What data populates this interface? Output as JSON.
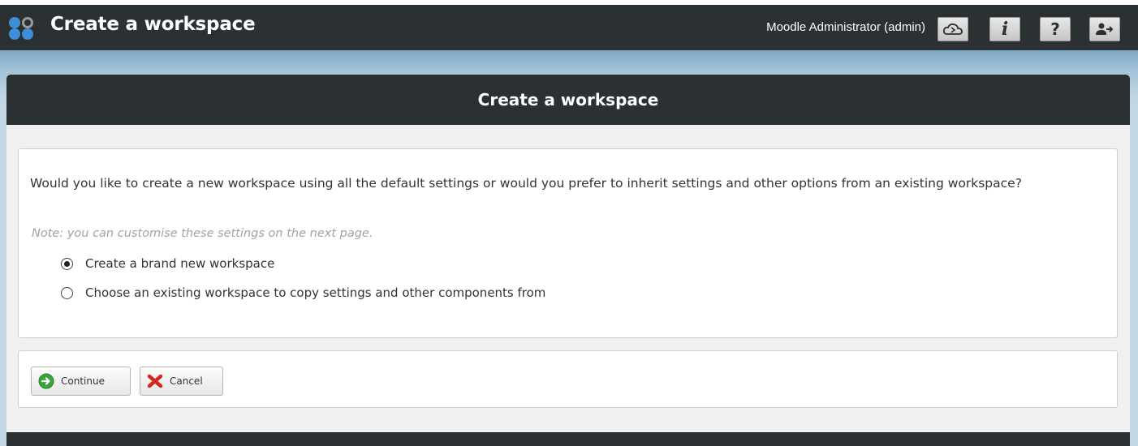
{
  "topbar": {
    "app_title": "Create a workspace",
    "user_name": "Moodle Administrator (admin)",
    "buttons": [
      {
        "icon": "cloud-icon"
      },
      {
        "icon": "info-icon",
        "glyph": "i"
      },
      {
        "icon": "help-icon",
        "glyph": "?"
      },
      {
        "icon": "logout-icon"
      }
    ]
  },
  "panel": {
    "title": "Create a workspace",
    "question": "Would you like to create a new workspace using all the default settings or would you prefer to inherit settings and other options from an existing workspace?",
    "note": "Note: you can customise these settings on the next page.",
    "options": [
      {
        "label": "Create a brand new workspace",
        "selected": true
      },
      {
        "label": "Choose an existing workspace to copy settings and other components from",
        "selected": false
      }
    ]
  },
  "actions": {
    "continue_label": "Continue",
    "cancel_label": "Cancel"
  },
  "colors": {
    "header_bg": "#2b3032",
    "band_blue": "#a9c6da",
    "continue_green": "#3aa63a",
    "cancel_red": "#d42a1c"
  }
}
